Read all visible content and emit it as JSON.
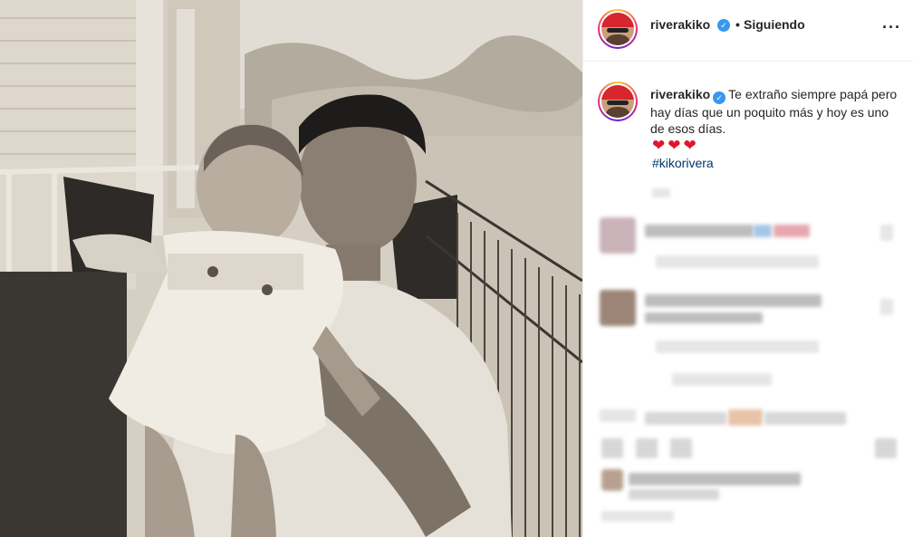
{
  "post": {
    "username": "riverakiko",
    "verified_mark": "✓",
    "separator": "•",
    "following_label": "Siguiendo",
    "more_label": "···",
    "photo_alt": "vintage-black-and-white-photo"
  },
  "caption": {
    "username": "riverakiko",
    "text": "Te extraño siempre papá pero hay días que un poquito más y hoy es uno de esos días.",
    "hearts": "❤❤❤",
    "hashtag": "#kikorivera"
  },
  "colors": {
    "verified": "#3897f0",
    "hashtag": "#003569",
    "heart": "#e0152c"
  },
  "icons": [
    "verified-badge-icon",
    "more-options-icon",
    "heart-emoji-icon"
  ]
}
